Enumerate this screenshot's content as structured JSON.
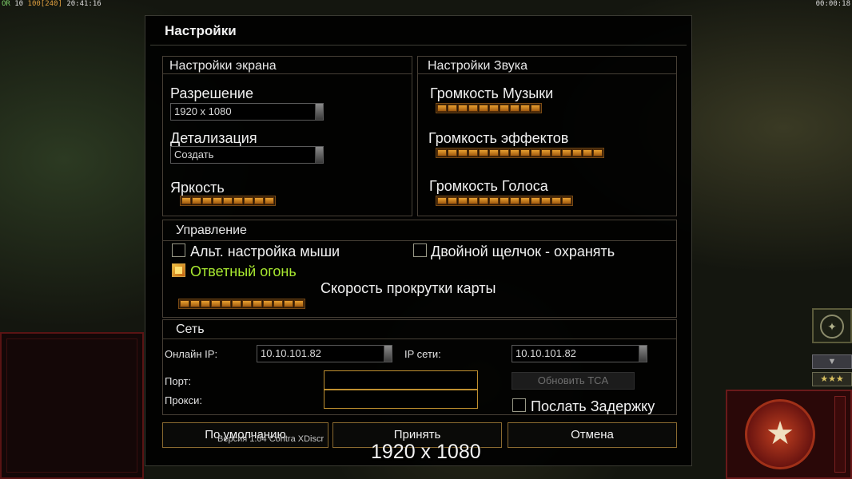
{
  "hud": {
    "left_prefix": "OR",
    "left_a": "10",
    "left_b": "100",
    "left_c": "[240]",
    "left_time": "20:41:16",
    "right_time": "00:00:18"
  },
  "dialog": {
    "title": "Настройки",
    "screen": {
      "title": "Настройки экрана",
      "resolution_label": "Разрешение",
      "resolution_value": "1920 x 1080",
      "detail_label": "Детализация",
      "detail_value": "Создать",
      "brightness_label": "Яркость",
      "brightness_level": 9
    },
    "sound": {
      "title": "Настройки Звука",
      "music_label": "Громкость Музыки",
      "music_level": 10,
      "effects_label": "Громкость эффектов",
      "effects_level": 16,
      "voice_label": "Громкость Голоса",
      "voice_level": 13
    },
    "controls": {
      "title": "Управление",
      "alt_mouse_label": "Альт. настройка мыши",
      "alt_mouse_checked": false,
      "double_click_label": "Двойной щелчок - охранять",
      "double_click_checked": false,
      "return_fire_label": "Ответный огонь",
      "return_fire_checked": true,
      "scroll_speed_label": "Скорость прокрутки карты",
      "scroll_speed_level": 12
    },
    "network": {
      "title": "Сеть",
      "online_ip_label": "Онлайн IP:",
      "online_ip_value": "10.10.101.82",
      "lan_ip_label": "IP сети:",
      "lan_ip_value": "10.10.101.82",
      "port_label": "Порт:",
      "port_value": "",
      "proxy_label": "Прокси:",
      "proxy_value": "",
      "update_button": "Обновить TCA",
      "send_delay_label": "Послать Задержку",
      "send_delay_checked": false
    },
    "buttons": {
      "defaults": "По умолчанию",
      "accept": "Принять",
      "cancel": "Отмена"
    },
    "version": "Версия 1.04 Contra XDiscr"
  },
  "overlay": {
    "resolution_text": "1920 x 1080"
  },
  "colors": {
    "accent_gold": "#c09030",
    "return_fire_text": "#a8e830",
    "slider_segment": "#e8a030"
  }
}
